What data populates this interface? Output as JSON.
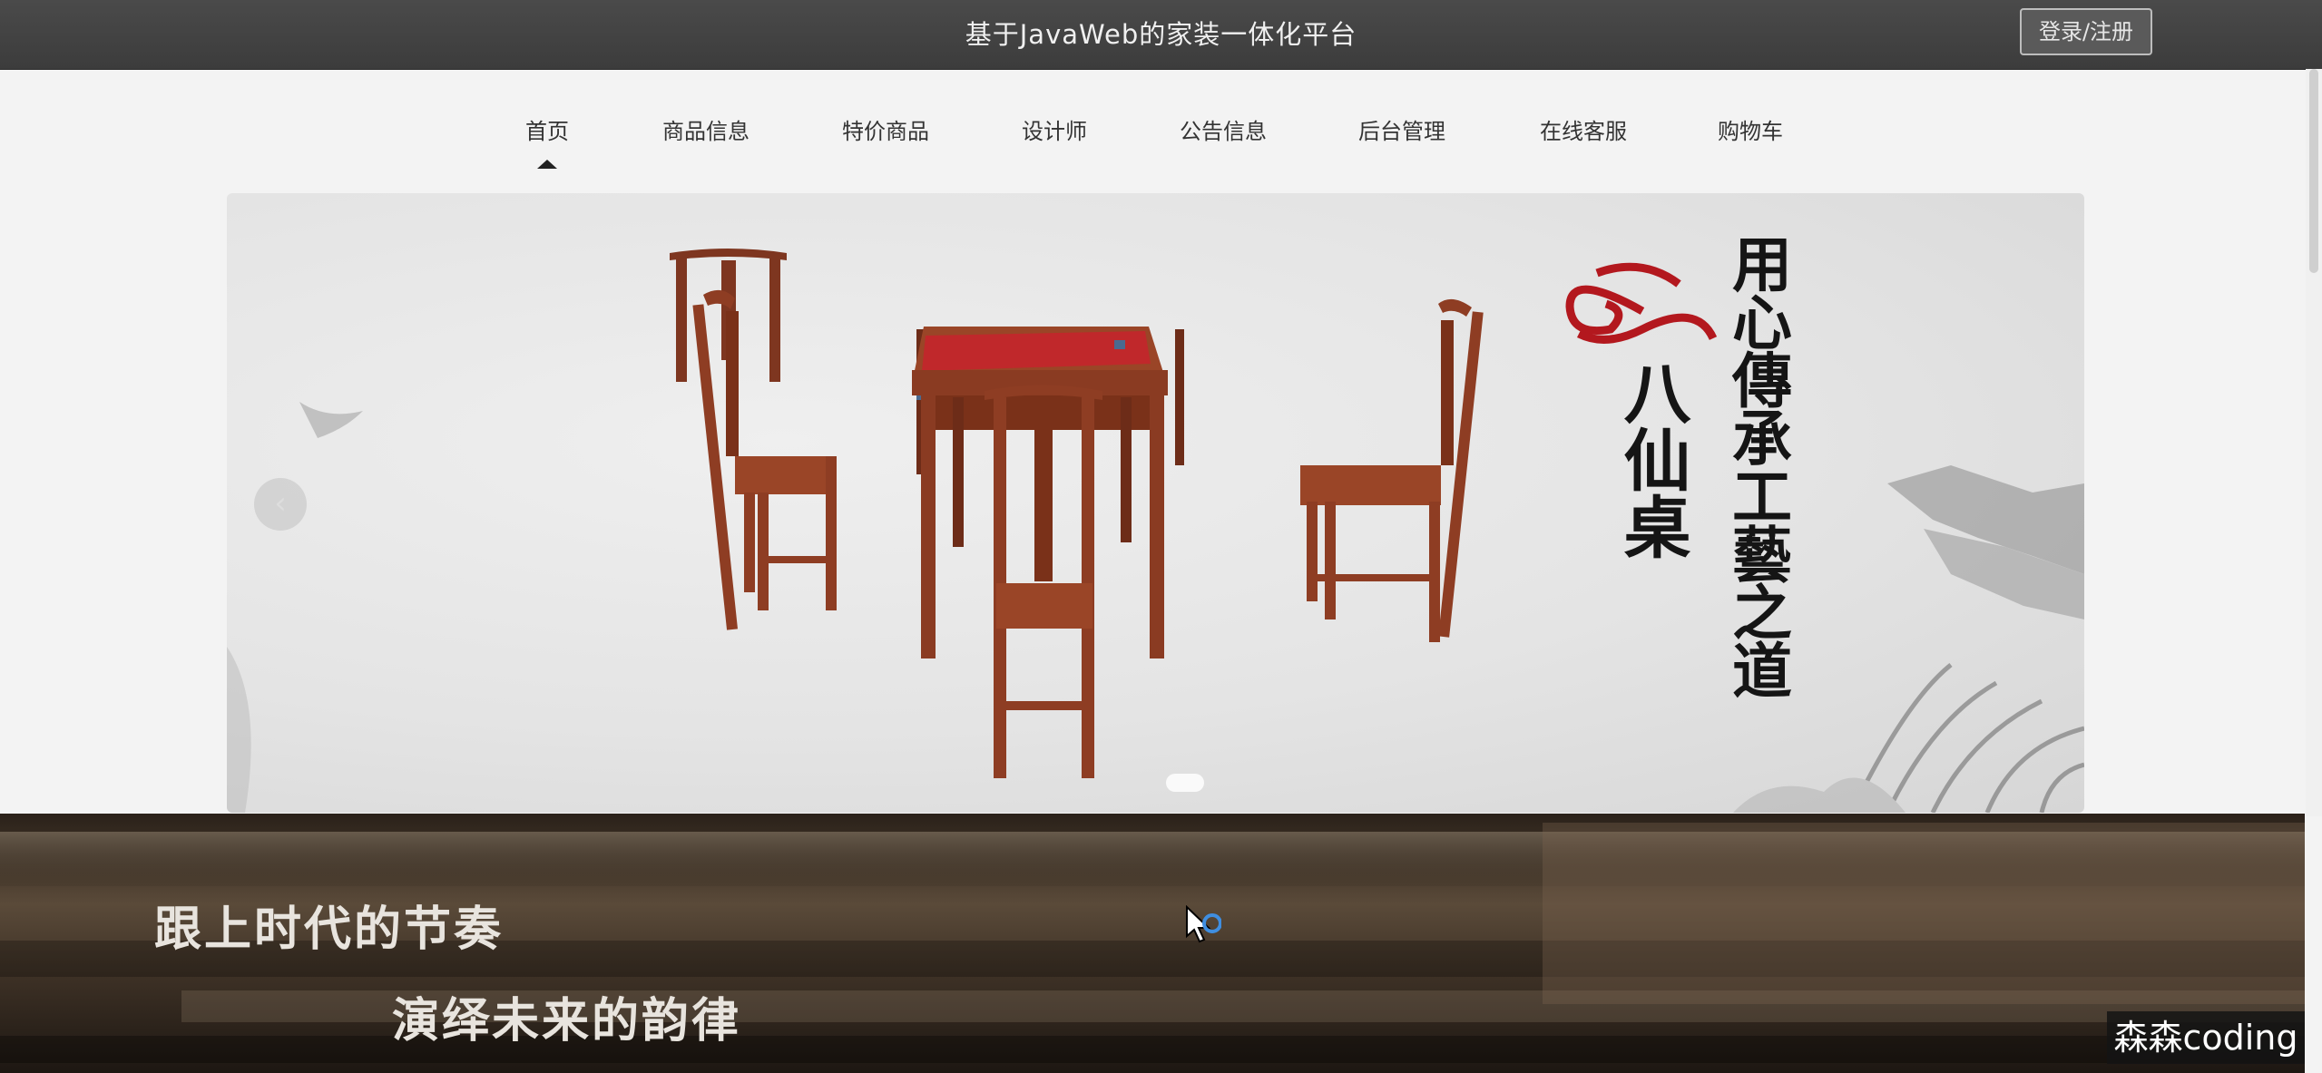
{
  "header": {
    "site_title": "基于JavaWeb的家装一体化平台",
    "login_label": "登录/注册"
  },
  "nav": {
    "active_index": 0,
    "items": [
      "首页",
      "商品信息",
      "特价商品",
      "设计师",
      "公告信息",
      "后台管理",
      "在线客服",
      "购物车"
    ]
  },
  "banner": {
    "product_name": "八仙桌",
    "tagline": "用心傳承工藝之道",
    "slide_count": 1
  },
  "promo": {
    "line1": "跟上时代的节奏",
    "line2": "演绎未来的韵律"
  },
  "watermark": "森森coding",
  "colors": {
    "topbar": "#444444",
    "page_bg": "#f3f3f3",
    "furniture": "#8a3b22",
    "runner": "#c0282b",
    "cloud_emblem": "#b3181e"
  }
}
